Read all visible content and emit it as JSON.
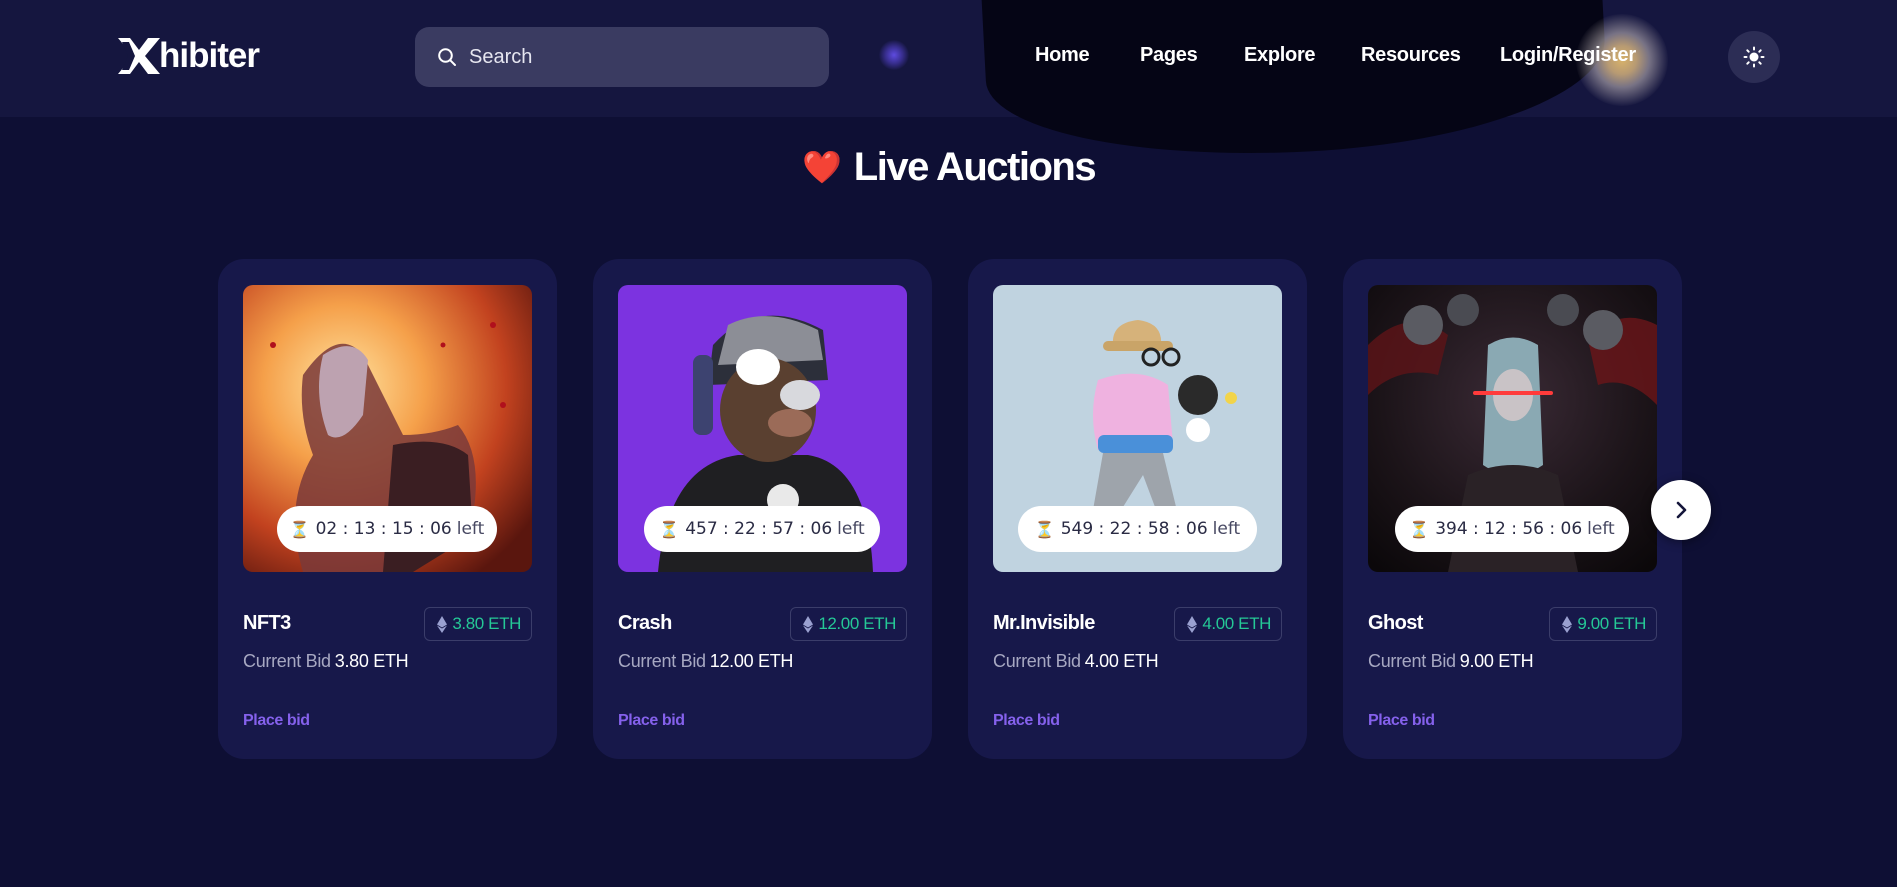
{
  "header": {
    "logo_text": "hibiter",
    "search": {
      "placeholder": "Search",
      "value": ""
    },
    "nav": [
      {
        "label": "Home"
      },
      {
        "label": "Pages"
      },
      {
        "label": "Explore"
      },
      {
        "label": "Resources"
      },
      {
        "label": "Login/Register"
      }
    ],
    "theme_toggle_icon": "sun-icon"
  },
  "section": {
    "emoji": "❤️",
    "title": "Live Auctions"
  },
  "cards": [
    {
      "name": "NFT3",
      "price": "3.80 ETH",
      "bid_label": "Current Bid",
      "bid_amount": "3.80 ETH",
      "timer": "02 : 13 : 15 : 06",
      "timer_suffix": "left",
      "action": "Place bid"
    },
    {
      "name": "Crash",
      "price": "12.00 ETH",
      "bid_label": "Current Bid",
      "bid_amount": "12.00 ETH",
      "timer": "457 : 22 : 57 : 06",
      "timer_suffix": "left",
      "action": "Place bid"
    },
    {
      "name": "Mr.Invisible",
      "price": "4.00 ETH",
      "bid_label": "Current Bid",
      "bid_amount": "4.00 ETH",
      "timer": "549 : 22 : 58 : 06",
      "timer_suffix": "left",
      "action": "Place bid"
    },
    {
      "name": "Ghost",
      "price": "9.00 ETH",
      "bid_label": "Current Bid",
      "bid_amount": "9.00 ETH",
      "timer": "394 : 12 : 56 : 06",
      "timer_suffix": "left",
      "action": "Place bid"
    }
  ],
  "carousel": {
    "next_icon": "chevron-right-icon"
  },
  "colors": {
    "background": "#0e0f34",
    "header": "#15163f",
    "card": "#17184a",
    "accent_purple": "#8561ec",
    "eth_green": "#25c896"
  }
}
